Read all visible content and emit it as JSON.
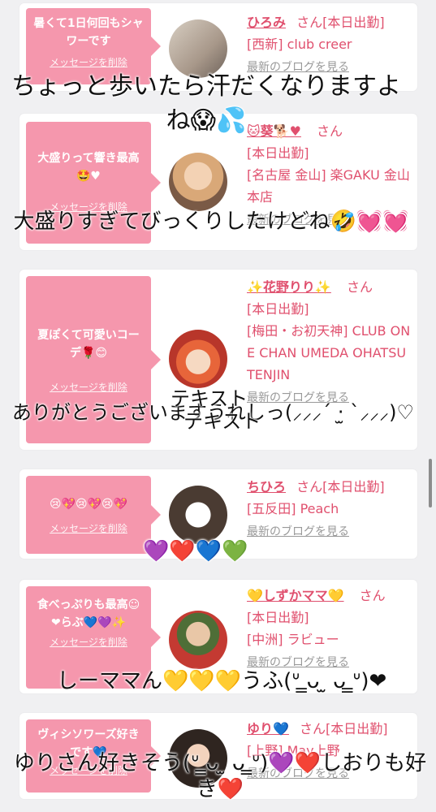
{
  "common": {
    "delete_label": "メッセージを削除",
    "blog_label": "最新のブログを見る",
    "san": "さん"
  },
  "cards": [
    {
      "bubble": "暑くて1日何回もシャワーです",
      "name": "ひろみ",
      "lines": [
        "さん[本日出勤]",
        "[西新] club creer"
      ]
    },
    {
      "bubble": "大盛りって響き最高🤩♥",
      "name": "🐱葵🐕♥",
      "lines": [
        "[本日出勤]",
        "[名古屋 金山] 楽GAKU 金山本店"
      ]
    },
    {
      "bubble": "夏ぽくて可愛いコーデ🌹😊",
      "name": "✨花野りり✨",
      "lines": [
        "[本日出勤]",
        "[梅田・お初天神] CLUB ONE CHAN UMEDA OHATSUTENJIN"
      ]
    },
    {
      "bubble": "😢💖😢💖😢💖",
      "name": "ちひろ",
      "lines": [
        "さん[本日出勤]",
        "[五反田] Peach"
      ]
    },
    {
      "bubble": "食べっぷりも最高☺❤らぶ💙💜✨",
      "name": "💛しずかママ💛",
      "lines": [
        "[本日出勤]",
        "[中洲] ラビュー"
      ]
    },
    {
      "bubble": "ヴィシソワーズ好きです💙",
      "name": "ゆり💙",
      "lines": [
        "さん[本日出勤]",
        "[上野] May上野"
      ]
    }
  ],
  "overlays": [
    "ちょっと歩いたら汗だくなりますよね😱💦",
    "大盛りすぎてびっくりしたけどね🤣💓💓",
    "ありがとうございますうれしっ(⸝⸝⸝´ ‧̫ `⸝⸝⸝)♡",
    "テキスト",
    "テキスト",
    "💜❤️💙💚",
    "しーママん💛💛💛うふ(ᐡ ̳ᴗ  ̫ ᴗ ̳ᐡ)❤",
    "ゆりさん好きそう(ᐡ ̳ᴗ  ̫ ᴗ ̳ᐡ)💜❤️しおりも好き❤️"
  ],
  "colors": {
    "bubble": "#f597ad",
    "name": "#e0506e",
    "background": "#f0f0f2"
  }
}
